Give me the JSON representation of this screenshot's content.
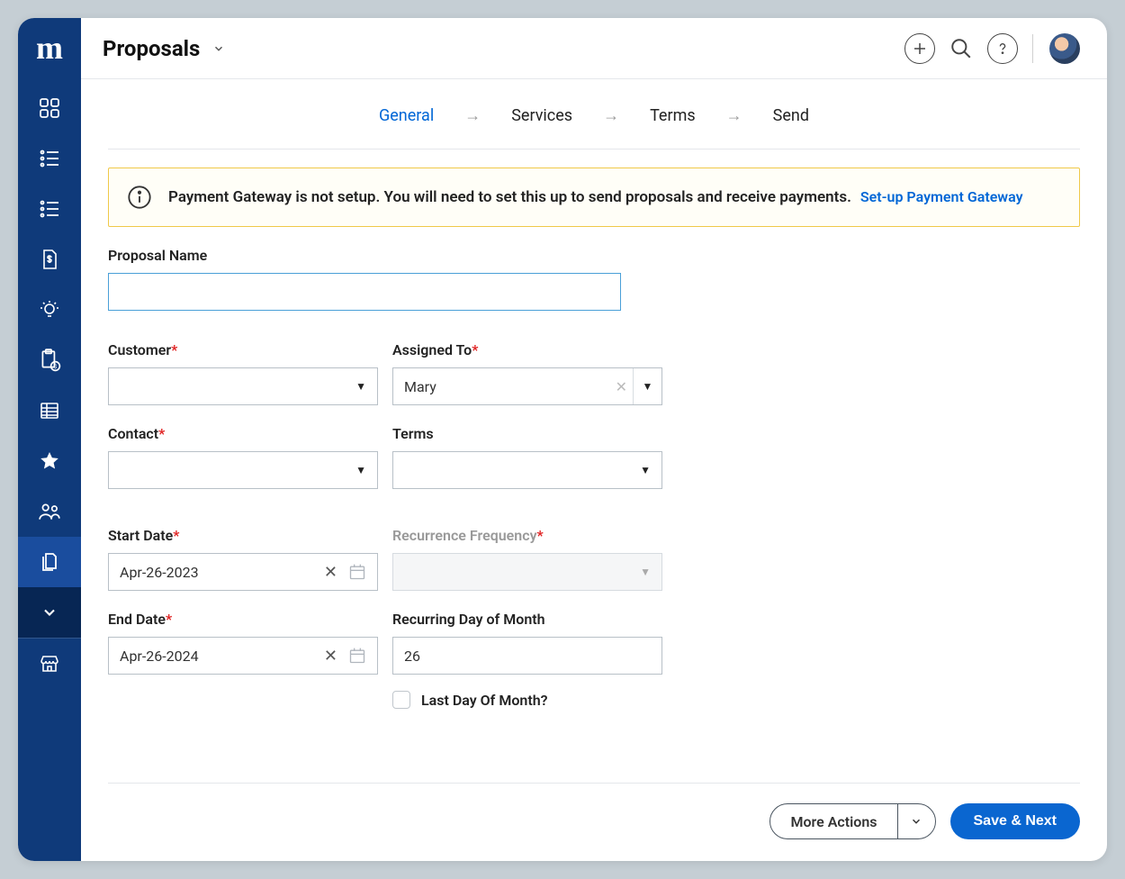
{
  "header": {
    "title": "Proposals"
  },
  "sidebar": {
    "logo": "m"
  },
  "stepper": {
    "steps": [
      "General",
      "Services",
      "Terms",
      "Send"
    ],
    "active_index": 0
  },
  "alert": {
    "text": "Payment Gateway is not setup. You will need to set this up to send proposals and receive payments.",
    "link_text": "Set-up Payment Gateway"
  },
  "form": {
    "proposal_name": {
      "label": "Proposal Name",
      "value": ""
    },
    "customer": {
      "label": "Customer",
      "value": ""
    },
    "assigned_to": {
      "label": "Assigned To",
      "value": "Mary"
    },
    "contact": {
      "label": "Contact",
      "value": ""
    },
    "terms": {
      "label": "Terms",
      "value": ""
    },
    "start_date": {
      "label": "Start Date",
      "value": "Apr-26-2023"
    },
    "recurrence_frequency": {
      "label": "Recurrence Frequency",
      "value": ""
    },
    "end_date": {
      "label": "End Date",
      "value": "Apr-26-2024"
    },
    "recurring_day": {
      "label": "Recurring Day of Month",
      "value": "26"
    },
    "last_day": {
      "label": "Last Day Of Month?",
      "checked": false
    }
  },
  "footer": {
    "more_actions": "More Actions",
    "save_next": "Save & Next"
  }
}
